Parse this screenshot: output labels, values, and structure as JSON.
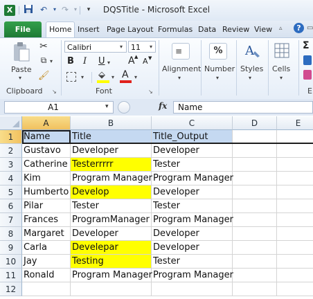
{
  "titlebar": {
    "title": "DQSTitle  -  Microsoft Excel"
  },
  "ribbon_tabs": [
    "File",
    "Home",
    "Insert",
    "Page Layout",
    "Formulas",
    "Data",
    "Review",
    "View"
  ],
  "clipboard": {
    "paste_label": "Paste",
    "group_label": "Clipboard"
  },
  "font": {
    "name": "Calibri",
    "size": "11",
    "bold": "B",
    "italic": "I",
    "underline": "U",
    "font_color_glyph": "A",
    "grow_glyph": "A",
    "shrink_glyph": "A",
    "group_label": "Font"
  },
  "groups": {
    "alignment": "Alignment",
    "number": "Number",
    "number_glyph": "%",
    "styles": "Styles",
    "cells": "Cells",
    "sigma": "Σ",
    "editing_partial": "E"
  },
  "formula_bar": {
    "name_box": "A1",
    "fx": "fx",
    "value": "Name"
  },
  "columns": [
    "A",
    "B",
    "C",
    "D",
    "E"
  ],
  "rows": [
    {
      "num": "1",
      "a": "Name",
      "b": "Title",
      "c": "Title_Output"
    },
    {
      "num": "2",
      "a": "Gustavo",
      "b": "Developer",
      "c": "Developer"
    },
    {
      "num": "3",
      "a": "Catherine",
      "b": "Testerrrrr",
      "c": "Tester"
    },
    {
      "num": "4",
      "a": "Kim",
      "b": "Program Manager",
      "c": "Program Manager"
    },
    {
      "num": "5",
      "a": "Humberto",
      "b": "Develop",
      "c": "Developer"
    },
    {
      "num": "6",
      "a": "Pilar",
      "b": "Tester",
      "c": "Tester"
    },
    {
      "num": "7",
      "a": "Frances",
      "b": "ProgramManager",
      "c": "Program Manager"
    },
    {
      "num": "8",
      "a": "Margaret",
      "b": "Developer",
      "c": "Developer"
    },
    {
      "num": "9",
      "a": "Carla",
      "b": "Develepar",
      "c": "Developer"
    },
    {
      "num": "10",
      "a": "Jay",
      "b": "Testing",
      "c": "Tester"
    },
    {
      "num": "11",
      "a": "Ronald",
      "b": "Program Manager",
      "c": "Program Manager"
    },
    {
      "num": "12",
      "a": "",
      "b": "",
      "c": ""
    }
  ],
  "colors": {
    "header_fill": "#c5d9f1",
    "highlight": "#ffff00",
    "file_tab": "#1e7a35"
  }
}
